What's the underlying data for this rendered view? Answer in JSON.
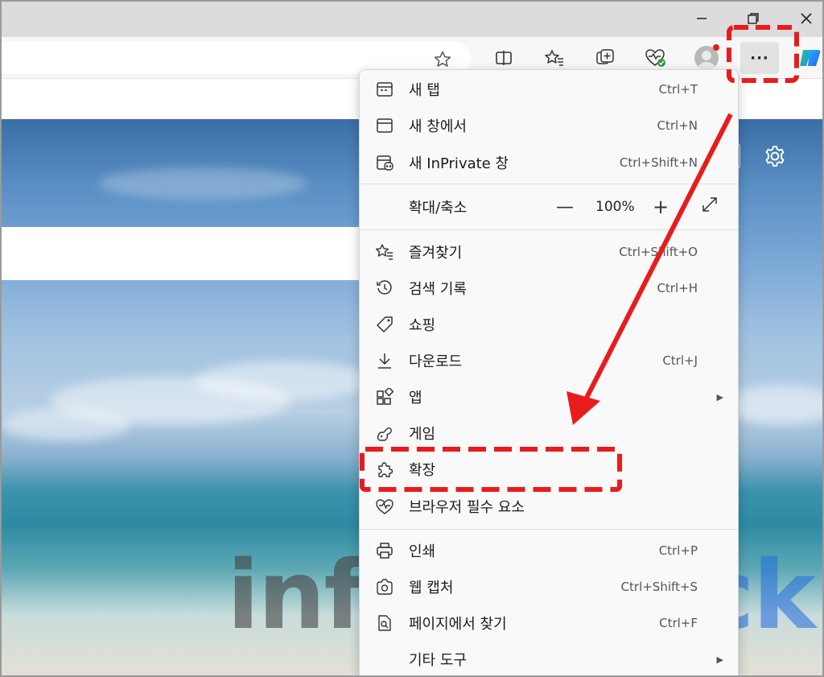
{
  "toolbar": {
    "more_label": "···"
  },
  "menu": {
    "items": [
      {
        "label": "새 탭",
        "shortcut": "Ctrl+T",
        "icon": "new-tab-icon"
      },
      {
        "label": "새 창에서",
        "shortcut": "Ctrl+N",
        "icon": "new-window-icon"
      },
      {
        "label": "새 InPrivate 창",
        "shortcut": "Ctrl+Shift+N",
        "icon": "inprivate-icon"
      },
      {
        "label": "확대/축소",
        "value": "100%"
      },
      {
        "label": "즐겨찾기",
        "shortcut": "Ctrl+Shift+O",
        "icon": "favorites-icon"
      },
      {
        "label": "검색 기록",
        "shortcut": "Ctrl+H",
        "icon": "history-icon"
      },
      {
        "label": "쇼핑",
        "icon": "shopping-tag-icon"
      },
      {
        "label": "다운로드",
        "shortcut": "Ctrl+J",
        "icon": "download-icon"
      },
      {
        "label": "앱",
        "icon": "apps-icon"
      },
      {
        "label": "게임",
        "icon": "games-icon"
      },
      {
        "label": "확장",
        "icon": "extensions-puzzle-icon"
      },
      {
        "label": "브라우저 필수 요소",
        "icon": "browser-essentials-icon"
      },
      {
        "label": "인쇄",
        "shortcut": "Ctrl+P",
        "icon": "print-icon"
      },
      {
        "label": "웹 캡처",
        "shortcut": "Ctrl+Shift+S",
        "icon": "web-capture-icon"
      },
      {
        "label": "페이지에서 찾기",
        "shortcut": "Ctrl+F",
        "icon": "find-in-page-icon"
      },
      {
        "label": "기타 도구"
      }
    ]
  },
  "watermark": {
    "part1": "inform",
    "part2": "hack"
  },
  "colors": {
    "annotation": "#e81c1c",
    "watermark_blue": "#2f6fd6"
  }
}
